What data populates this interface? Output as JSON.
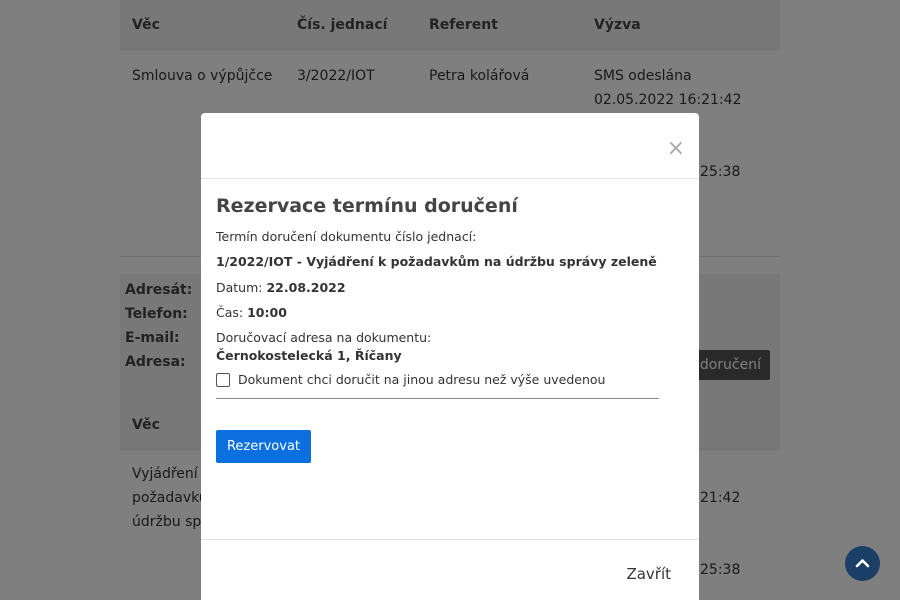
{
  "table": {
    "headers": [
      "Věc",
      "Čís. jednací",
      "Referent",
      "Výzva"
    ],
    "row1": {
      "vec": "Smlouva o výpůjčce",
      "cislo": "3/2022/IOT",
      "referent": "Petra kolářová",
      "vyzva_line1": "SMS odeslána",
      "vyzva_line2": "02.05.2022 16:21:42",
      "vyzva_line3": "25:38"
    }
  },
  "adresat": {
    "labels": [
      "Adresát:",
      "Telefon:",
      "E-mail:",
      "Adresa:"
    ],
    "button": "doručení"
  },
  "table2": {
    "header_vec": "Věc",
    "row_vec": [
      "Vyjádření k",
      "požadavků",
      "údržbu spr"
    ],
    "vyzva_line1": "21:42",
    "vyzva_line2": "25:38"
  },
  "modal": {
    "close_symbol": "×",
    "title": "Rezervace termínu doručení",
    "intro": "Termín doručení dokumentu číslo jednací:",
    "document": "1/2022/IOT - Vyjádření k požadavkům na údržbu správy zeleně",
    "date_label": "Datum:",
    "date_value": "22.08.2022",
    "time_label": "Čas:",
    "time_value": "10:00",
    "address_label": "Doručovací adresa na dokumentu:",
    "address_value": "Černokostelecká 1, Říčany",
    "checkbox_label": "Dokument chci doručit na jinou adresu než výše uvedenou",
    "submit": "Rezervovat",
    "close_link": "Zavřít"
  },
  "colors": {
    "primary": "#0b6fe0",
    "overlay": "rgba(0,0,0,0.5)",
    "scroll_top": "#1c3f67"
  },
  "icons": {
    "scroll_top": "chevron-up-icon",
    "close": "close-icon",
    "checkbox": "checkbox-icon"
  }
}
